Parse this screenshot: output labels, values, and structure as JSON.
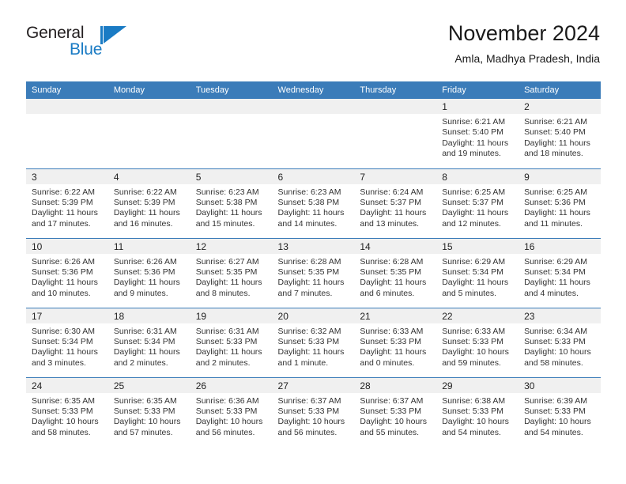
{
  "brand": {
    "word_one": "General",
    "word_two": "Blue",
    "flag_icon": "triangle-flag-icon",
    "accent_color": "#1a7bc4"
  },
  "header": {
    "title": "November 2024",
    "subtitle": "Amla, Madhya Pradesh, India"
  },
  "theme": {
    "header_blue": "#3b7cb9",
    "daynum_gray": "#f0f0f0",
    "text": "#222222"
  },
  "calendar": {
    "weekday_headers": [
      "Sunday",
      "Monday",
      "Tuesday",
      "Wednesday",
      "Thursday",
      "Friday",
      "Saturday"
    ],
    "weeks": [
      [
        {
          "day": "",
          "lines": []
        },
        {
          "day": "",
          "lines": []
        },
        {
          "day": "",
          "lines": []
        },
        {
          "day": "",
          "lines": []
        },
        {
          "day": "",
          "lines": []
        },
        {
          "day": "1",
          "lines": [
            "Sunrise: 6:21 AM",
            "Sunset: 5:40 PM",
            "Daylight: 11 hours",
            "and 19 minutes."
          ]
        },
        {
          "day": "2",
          "lines": [
            "Sunrise: 6:21 AM",
            "Sunset: 5:40 PM",
            "Daylight: 11 hours",
            "and 18 minutes."
          ]
        }
      ],
      [
        {
          "day": "3",
          "lines": [
            "Sunrise: 6:22 AM",
            "Sunset: 5:39 PM",
            "Daylight: 11 hours",
            "and 17 minutes."
          ]
        },
        {
          "day": "4",
          "lines": [
            "Sunrise: 6:22 AM",
            "Sunset: 5:39 PM",
            "Daylight: 11 hours",
            "and 16 minutes."
          ]
        },
        {
          "day": "5",
          "lines": [
            "Sunrise: 6:23 AM",
            "Sunset: 5:38 PM",
            "Daylight: 11 hours",
            "and 15 minutes."
          ]
        },
        {
          "day": "6",
          "lines": [
            "Sunrise: 6:23 AM",
            "Sunset: 5:38 PM",
            "Daylight: 11 hours",
            "and 14 minutes."
          ]
        },
        {
          "day": "7",
          "lines": [
            "Sunrise: 6:24 AM",
            "Sunset: 5:37 PM",
            "Daylight: 11 hours",
            "and 13 minutes."
          ]
        },
        {
          "day": "8",
          "lines": [
            "Sunrise: 6:25 AM",
            "Sunset: 5:37 PM",
            "Daylight: 11 hours",
            "and 12 minutes."
          ]
        },
        {
          "day": "9",
          "lines": [
            "Sunrise: 6:25 AM",
            "Sunset: 5:36 PM",
            "Daylight: 11 hours",
            "and 11 minutes."
          ]
        }
      ],
      [
        {
          "day": "10",
          "lines": [
            "Sunrise: 6:26 AM",
            "Sunset: 5:36 PM",
            "Daylight: 11 hours",
            "and 10 minutes."
          ]
        },
        {
          "day": "11",
          "lines": [
            "Sunrise: 6:26 AM",
            "Sunset: 5:36 PM",
            "Daylight: 11 hours",
            "and 9 minutes."
          ]
        },
        {
          "day": "12",
          "lines": [
            "Sunrise: 6:27 AM",
            "Sunset: 5:35 PM",
            "Daylight: 11 hours",
            "and 8 minutes."
          ]
        },
        {
          "day": "13",
          "lines": [
            "Sunrise: 6:28 AM",
            "Sunset: 5:35 PM",
            "Daylight: 11 hours",
            "and 7 minutes."
          ]
        },
        {
          "day": "14",
          "lines": [
            "Sunrise: 6:28 AM",
            "Sunset: 5:35 PM",
            "Daylight: 11 hours",
            "and 6 minutes."
          ]
        },
        {
          "day": "15",
          "lines": [
            "Sunrise: 6:29 AM",
            "Sunset: 5:34 PM",
            "Daylight: 11 hours",
            "and 5 minutes."
          ]
        },
        {
          "day": "16",
          "lines": [
            "Sunrise: 6:29 AM",
            "Sunset: 5:34 PM",
            "Daylight: 11 hours",
            "and 4 minutes."
          ]
        }
      ],
      [
        {
          "day": "17",
          "lines": [
            "Sunrise: 6:30 AM",
            "Sunset: 5:34 PM",
            "Daylight: 11 hours",
            "and 3 minutes."
          ]
        },
        {
          "day": "18",
          "lines": [
            "Sunrise: 6:31 AM",
            "Sunset: 5:34 PM",
            "Daylight: 11 hours",
            "and 2 minutes."
          ]
        },
        {
          "day": "19",
          "lines": [
            "Sunrise: 6:31 AM",
            "Sunset: 5:33 PM",
            "Daylight: 11 hours",
            "and 2 minutes."
          ]
        },
        {
          "day": "20",
          "lines": [
            "Sunrise: 6:32 AM",
            "Sunset: 5:33 PM",
            "Daylight: 11 hours",
            "and 1 minute."
          ]
        },
        {
          "day": "21",
          "lines": [
            "Sunrise: 6:33 AM",
            "Sunset: 5:33 PM",
            "Daylight: 11 hours",
            "and 0 minutes."
          ]
        },
        {
          "day": "22",
          "lines": [
            "Sunrise: 6:33 AM",
            "Sunset: 5:33 PM",
            "Daylight: 10 hours",
            "and 59 minutes."
          ]
        },
        {
          "day": "23",
          "lines": [
            "Sunrise: 6:34 AM",
            "Sunset: 5:33 PM",
            "Daylight: 10 hours",
            "and 58 minutes."
          ]
        }
      ],
      [
        {
          "day": "24",
          "lines": [
            "Sunrise: 6:35 AM",
            "Sunset: 5:33 PM",
            "Daylight: 10 hours",
            "and 58 minutes."
          ]
        },
        {
          "day": "25",
          "lines": [
            "Sunrise: 6:35 AM",
            "Sunset: 5:33 PM",
            "Daylight: 10 hours",
            "and 57 minutes."
          ]
        },
        {
          "day": "26",
          "lines": [
            "Sunrise: 6:36 AM",
            "Sunset: 5:33 PM",
            "Daylight: 10 hours",
            "and 56 minutes."
          ]
        },
        {
          "day": "27",
          "lines": [
            "Sunrise: 6:37 AM",
            "Sunset: 5:33 PM",
            "Daylight: 10 hours",
            "and 56 minutes."
          ]
        },
        {
          "day": "28",
          "lines": [
            "Sunrise: 6:37 AM",
            "Sunset: 5:33 PM",
            "Daylight: 10 hours",
            "and 55 minutes."
          ]
        },
        {
          "day": "29",
          "lines": [
            "Sunrise: 6:38 AM",
            "Sunset: 5:33 PM",
            "Daylight: 10 hours",
            "and 54 minutes."
          ]
        },
        {
          "day": "30",
          "lines": [
            "Sunrise: 6:39 AM",
            "Sunset: 5:33 PM",
            "Daylight: 10 hours",
            "and 54 minutes."
          ]
        }
      ]
    ]
  }
}
